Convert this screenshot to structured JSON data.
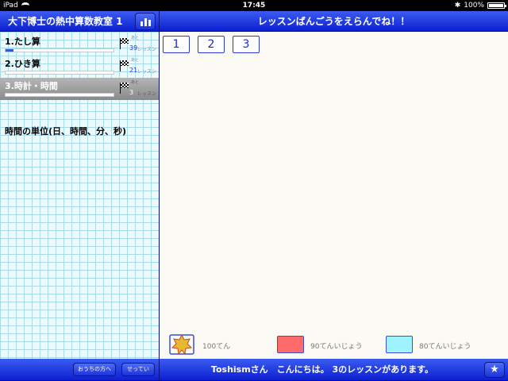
{
  "status_bar": {
    "device": "iPad",
    "time": "17:45",
    "battery": "100%"
  },
  "sidebar": {
    "title": "大下博士の熱中算数教室 1",
    "lessons": [
      {
        "label": "1.たし算",
        "progress": 0.07,
        "remain_small": "あと",
        "remain_count": "39",
        "remain_unit": "レッスン"
      },
      {
        "label": "2.ひき算",
        "progress": 0.0,
        "remain_small": "あと",
        "remain_count": "21",
        "remain_unit": "レッスン"
      },
      {
        "label": "3.時計・時間",
        "progress": 0.0,
        "remain_small": "あと",
        "remain_count": "3",
        "remain_unit": "レッスン"
      }
    ],
    "selected_description": "時間の単位(日、時間、分、秒)",
    "footer": {
      "parents_button": "おうちの方へ",
      "settings_button": "せってい"
    }
  },
  "main": {
    "title": "レッスンばんごうをえらんでね！！",
    "lesson_buttons": [
      "1",
      "2",
      "3"
    ],
    "legend": [
      {
        "label": "100てん",
        "color": "#e8b830"
      },
      {
        "label": "90てんいじょう",
        "color": "#ff6a6a"
      },
      {
        "label": "80てんいじょう",
        "color": "#9ff2ff"
      }
    ],
    "footer_message": "Toshismさん　こんにちは。 3のレッスンがあります。"
  },
  "colors": {
    "accent": "#1a2ad8",
    "header_blue": "#0d1fd0"
  }
}
